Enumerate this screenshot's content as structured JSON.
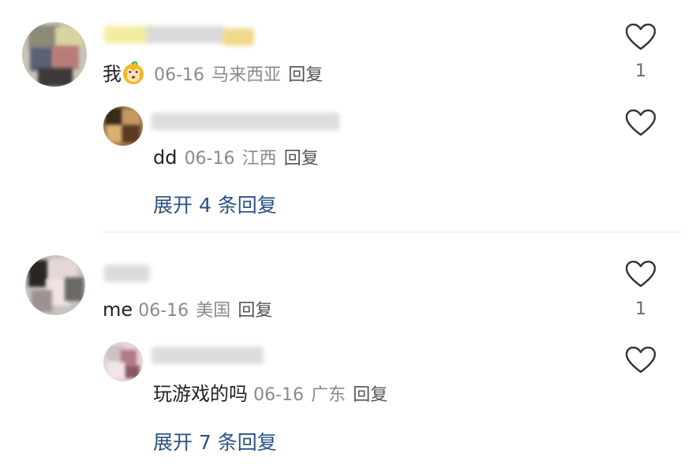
{
  "comments": [
    {
      "text": "我",
      "date": "06-16",
      "location": "马来西亚",
      "reply_label": "回复",
      "likes": "1",
      "replies": [
        {
          "text": "dd",
          "date": "06-16",
          "location": "江西",
          "reply_label": "回复"
        }
      ],
      "expand_label": "展开 4 条回复"
    },
    {
      "text": "me",
      "date": "06-16",
      "location": "美国",
      "reply_label": "回复",
      "likes": "1",
      "replies": [
        {
          "text": "玩游戏的吗",
          "date": "06-16",
          "location": "广东",
          "reply_label": "回复"
        }
      ],
      "expand_label": "展开 7 条回复"
    }
  ],
  "icons": {
    "like": "heart-outline-icon",
    "emoji": "monkey-emoji-icon"
  },
  "colors": {
    "expand_link": "#2a5285",
    "meta": "#8a8a8a",
    "divider": "#e6e6e6"
  }
}
